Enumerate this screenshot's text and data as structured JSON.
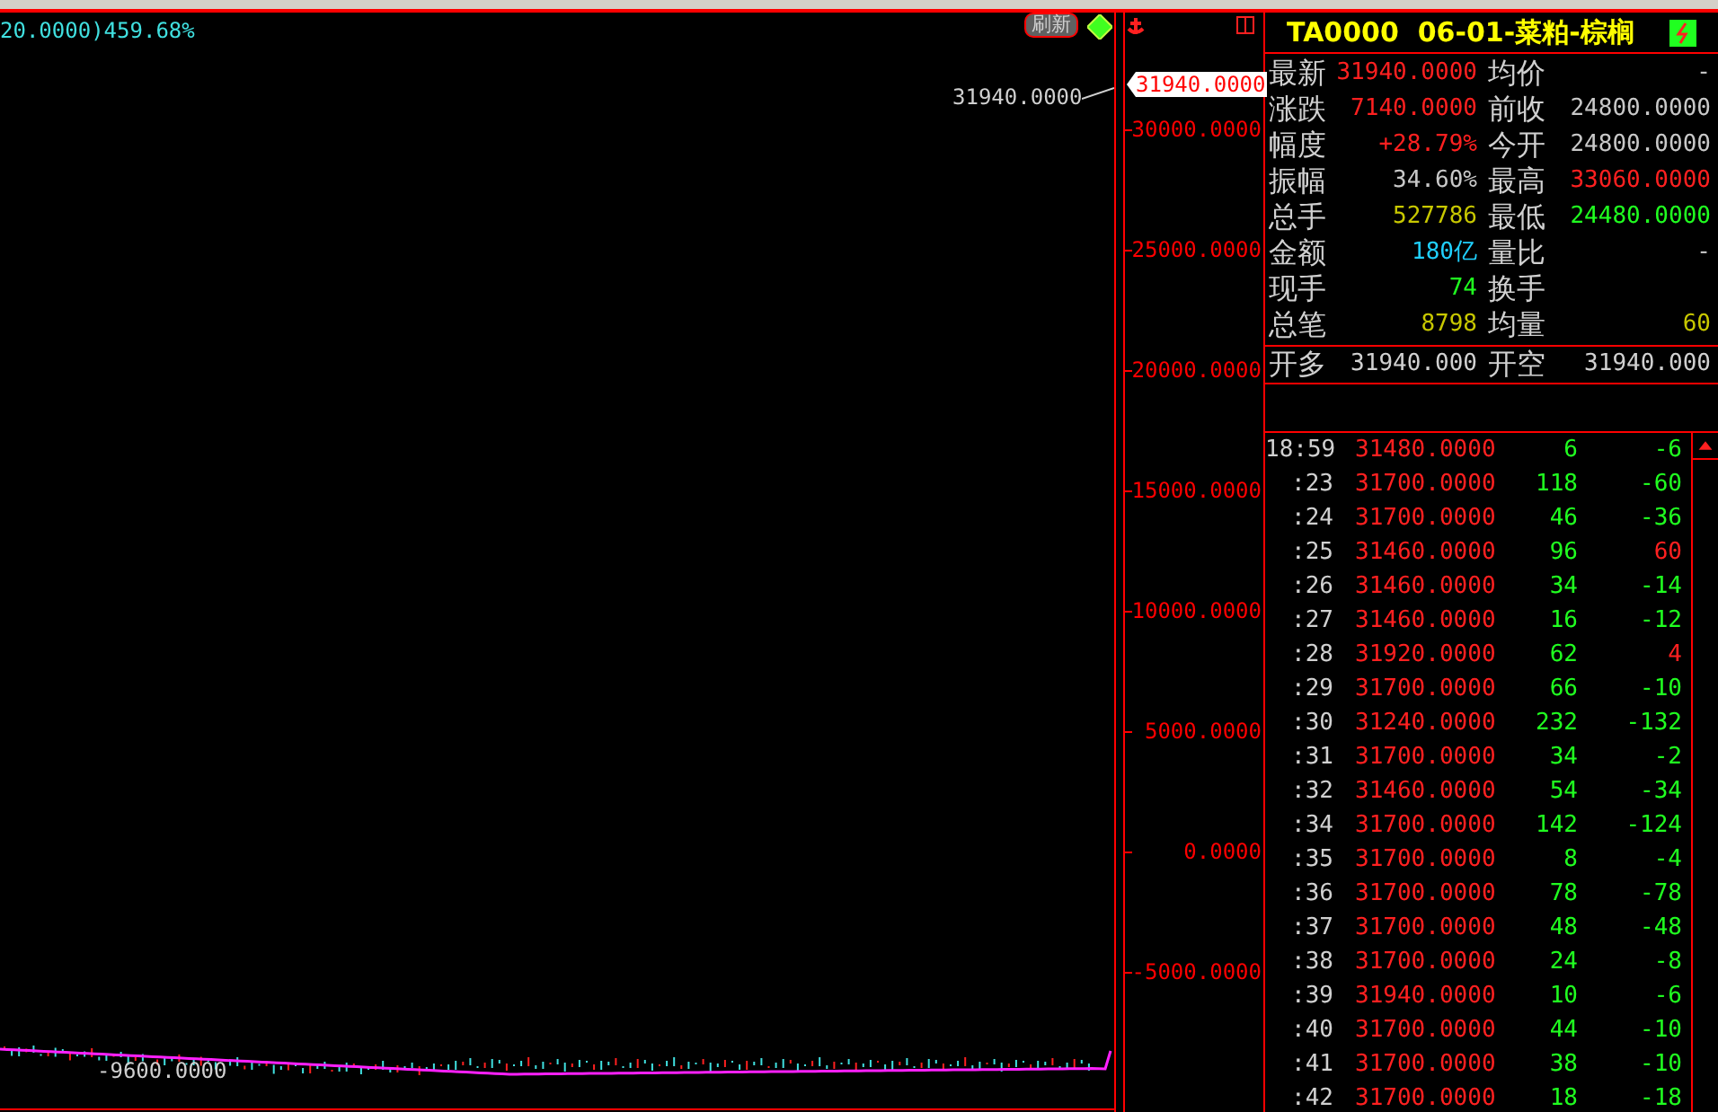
{
  "chart": {
    "legend": "20.0000)459.68%",
    "refresh_button": "刷新",
    "high_label": "31940.0000",
    "low_label": "-9600.0000",
    "price_tag": "31940.0000",
    "axis_ticks": [
      "30000.0000",
      "25000.0000",
      "20000.0000",
      "15000.0000",
      "10000.0000",
      "5000.0000",
      "0.0000",
      "-5000.0000"
    ]
  },
  "quote": {
    "title": "TA0000  06-01-菜粕-棕榈",
    "fields": [
      {
        "label": "最新",
        "value": "31940.0000",
        "color": "#ff2020"
      },
      {
        "label": "均价",
        "value": "-",
        "color": "#c8c8c8"
      },
      {
        "label": "涨跌",
        "value": "7140.0000",
        "color": "#ff2020"
      },
      {
        "label": "前收",
        "value": "24800.0000",
        "color": "#c8c8c8"
      },
      {
        "label": "幅度",
        "value": "+28.79%",
        "color": "#ff2020"
      },
      {
        "label": "今开",
        "value": "24800.0000",
        "color": "#c8c8c8"
      },
      {
        "label": "振幅",
        "value": "34.60%",
        "color": "#c8c8c8"
      },
      {
        "label": "最高",
        "value": "33060.0000",
        "color": "#ff2020"
      },
      {
        "label": "总手",
        "value": "527786",
        "color": "#c8c800"
      },
      {
        "label": "最低",
        "value": "24480.0000",
        "color": "#20ff20"
      },
      {
        "label": "金额",
        "value": "180亿",
        "color": "#20d0ff"
      },
      {
        "label": "量比",
        "value": "-",
        "color": "#c8c8c8"
      },
      {
        "label": "现手",
        "value": "74",
        "color": "#20ff20"
      },
      {
        "label": "换手"
      },
      {
        "label": "总笔",
        "value": "8798",
        "color": "#c8c800"
      },
      {
        "label": "均量",
        "value": "60",
        "color": "#c8c800"
      }
    ],
    "open_row": {
      "label": "开多",
      "value": "31940.000",
      "label2": "开空",
      "value2": "31940.000"
    }
  },
  "ticks": [
    {
      "time": "18:59",
      "price": "31480.0000",
      "volume": "6",
      "change": "-6",
      "color": "#20ff20"
    },
    {
      "time": ":23",
      "price": "31700.0000",
      "volume": "118",
      "change": "-60",
      "color": "#20ff20"
    },
    {
      "time": ":24",
      "price": "31700.0000",
      "volume": "46",
      "change": "-36",
      "color": "#20ff20"
    },
    {
      "time": ":25",
      "price": "31460.0000",
      "volume": "96",
      "change": "60",
      "color": "#ff2020"
    },
    {
      "time": ":26",
      "price": "31460.0000",
      "volume": "34",
      "change": "-14",
      "color": "#20ff20"
    },
    {
      "time": ":27",
      "price": "31460.0000",
      "volume": "16",
      "change": "-12",
      "color": "#20ff20"
    },
    {
      "time": ":28",
      "price": "31920.0000",
      "volume": "62",
      "change": "4",
      "color": "#ff2020"
    },
    {
      "time": ":29",
      "price": "31700.0000",
      "volume": "66",
      "change": "-10",
      "color": "#20ff20"
    },
    {
      "time": ":30",
      "price": "31240.0000",
      "volume": "232",
      "change": "-132",
      "color": "#20ff20"
    },
    {
      "time": ":31",
      "price": "31700.0000",
      "volume": "34",
      "change": "-2",
      "color": "#20ff20"
    },
    {
      "time": ":32",
      "price": "31460.0000",
      "volume": "54",
      "change": "-34",
      "color": "#20ff20"
    },
    {
      "time": ":34",
      "price": "31700.0000",
      "volume": "142",
      "change": "-124",
      "color": "#20ff20"
    },
    {
      "time": ":35",
      "price": "31700.0000",
      "volume": "8",
      "change": "-4",
      "color": "#20ff20"
    },
    {
      "time": ":36",
      "price": "31700.0000",
      "volume": "78",
      "change": "-78",
      "color": "#20ff20"
    },
    {
      "time": ":37",
      "price": "31700.0000",
      "volume": "48",
      "change": "-48",
      "color": "#20ff20"
    },
    {
      "time": ":38",
      "price": "31700.0000",
      "volume": "24",
      "change": "-8",
      "color": "#20ff20"
    },
    {
      "time": ":39",
      "price": "31940.0000",
      "volume": "10",
      "change": "-6",
      "color": "#20ff20"
    },
    {
      "time": ":40",
      "price": "31700.0000",
      "volume": "44",
      "change": "-10",
      "color": "#20ff20"
    },
    {
      "time": ":41",
      "price": "31700.0000",
      "volume": "38",
      "change": "-10",
      "color": "#20ff20"
    },
    {
      "time": ":42",
      "price": "31700.0000",
      "volume": "18",
      "change": "-18",
      "color": "#20ff20"
    }
  ]
}
